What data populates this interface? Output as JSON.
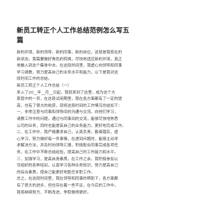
{
  "document": {
    "title_lines": [
      "新员工转正个人工作总结范例怎么写五",
      "篇"
    ],
    "body_lines": [
      "新的环境，新的领导，新的同事，新的岗位，这就是我现在的",
      "新状态。我需要做好角色的转换，尽快地适应新的环境，真正",
      "地融入到这个集体中去。在这段时间里，我虚心向领导和同事",
      "学习请教，努力提高自己的业务水平和能力，以下是我对这",
      "段时间工作的总结。",
      "新员工转正个人工作总结（一）",
      "来入了20__年__月__日起，我就来到了这里，成为这个大",
      "家庭中的一员，在这段试用期里，我在各方面都有了一定的提",
      "高，也有了很大的收获，现将这段时间的工作情况总结如下：",
      "一、非常注意与同事和领导间的沟通与交流，向他们学习，",
      "请教工作中的问题。通过与同事间的交流，能够尽快地熟悉",
      "公司的业务，同时也能提高自己的业务能力，更好地完成工作。",
      "二、在工作中，我严格要求自己，认真负责，勤奋踏实，虚",
      "心学习，努力做好每一件事情。在遇到问题时，能够主动寻",
      "求解决方法，并及时向领导汇报，积极配合同事完成各项任",
      "务，在工作中不断总结经验，提高自己的工作能力和水平。",
      "三、加强学习，提高自身素质。在工作之余，我积极参加公",
      "司组织的各种培训，认真学习各种业务知识，努力提高自己",
      "的综合素质，使自己能更好地胜任本职工作。",
      "总之，在这段时间里，我在领导和同事的帮助下，各方面都",
      "有了很大的进步，但也存在着一些不足，在今后的工作中，",
      "我将继续努力，不断改进，争取做得更好。"
    ]
  }
}
